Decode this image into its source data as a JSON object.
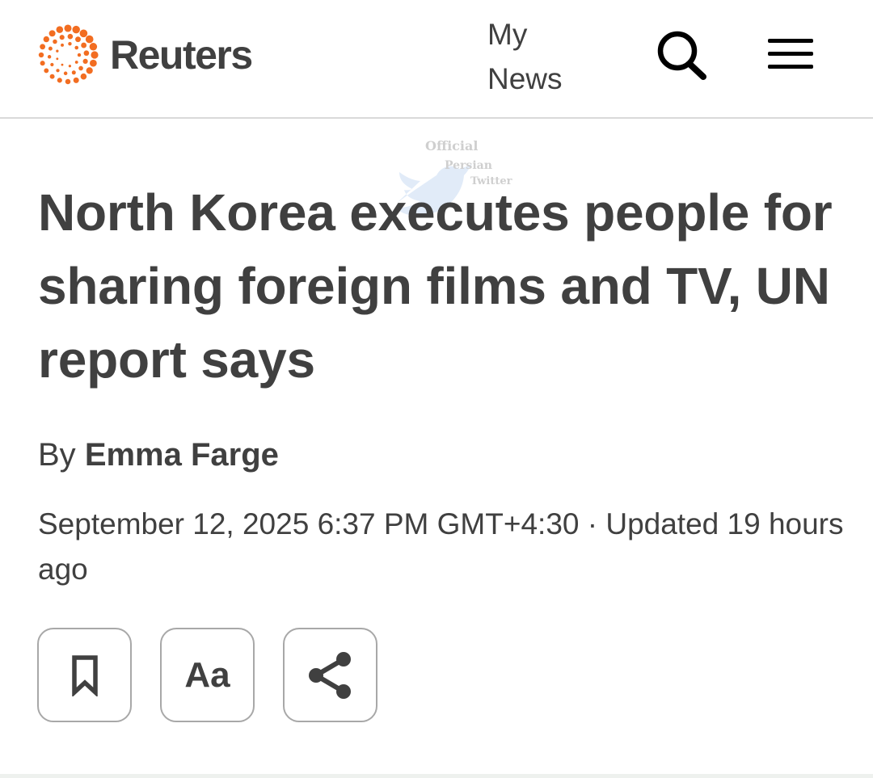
{
  "header": {
    "brand": "Reuters",
    "my_news_line1": "My",
    "my_news_line2": "News",
    "search_icon": "search-icon",
    "menu_icon": "hamburger-menu-icon",
    "brand_color": "#f26d21"
  },
  "watermark": {
    "line1": "Official",
    "line2": "Persian",
    "line3": "Twitter"
  },
  "article": {
    "headline": "North Korea executes people for sharing foreign films and TV, UN report says",
    "byline_prefix": "By",
    "author": "Emma Farge",
    "dateline": "September 12, 2025 6:37 PM GMT+4:30 · Updated 19 hours ago"
  },
  "actions": {
    "bookmark_icon": "bookmark-icon",
    "text_size_label": "Aa",
    "share_icon": "share-icon"
  }
}
